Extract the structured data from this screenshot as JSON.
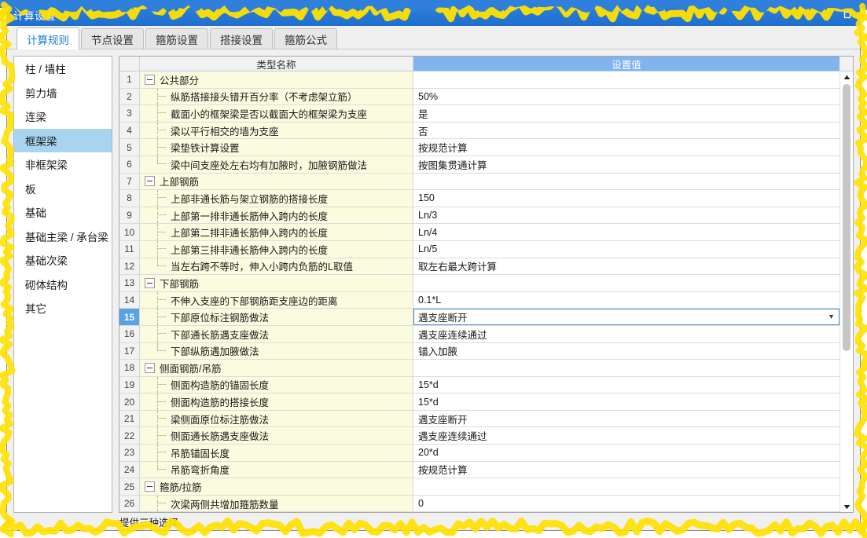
{
  "window": {
    "title": "计算设置",
    "minimize_label": "—",
    "maximize_label": "□"
  },
  "tabs": [
    {
      "label": "计算规则",
      "active": true
    },
    {
      "label": "节点设置",
      "active": false
    },
    {
      "label": "箍筋设置",
      "active": false
    },
    {
      "label": "搭接设置",
      "active": false
    },
    {
      "label": "箍筋公式",
      "active": false
    }
  ],
  "sidebar": {
    "items": [
      {
        "label": "柱 / 墙柱",
        "selected": false
      },
      {
        "label": "剪力墙",
        "selected": false
      },
      {
        "label": "连梁",
        "selected": false
      },
      {
        "label": "框架梁",
        "selected": true
      },
      {
        "label": "非框架梁",
        "selected": false
      },
      {
        "label": "板",
        "selected": false
      },
      {
        "label": "基础",
        "selected": false
      },
      {
        "label": "基础主梁 / 承台梁",
        "selected": false
      },
      {
        "label": "基础次梁",
        "selected": false
      },
      {
        "label": "砌体结构",
        "selected": false
      },
      {
        "label": "其它",
        "selected": false
      }
    ]
  },
  "grid": {
    "headers": {
      "number": "",
      "name": "类型名称",
      "value": "设置值"
    },
    "rows": [
      {
        "num": "1",
        "name": "公共部分",
        "value": "",
        "type": "group"
      },
      {
        "num": "2",
        "name": "纵筋搭接接头错开百分率（不考虑架立筋）",
        "value": "50%",
        "type": "child"
      },
      {
        "num": "3",
        "name": "截面小的框架梁是否以截面大的框架梁为支座",
        "value": "是",
        "type": "child"
      },
      {
        "num": "4",
        "name": "梁以平行相交的墙为支座",
        "value": "否",
        "type": "child"
      },
      {
        "num": "5",
        "name": "梁垫铁计算设置",
        "value": "按规范计算",
        "type": "child"
      },
      {
        "num": "6",
        "name": "梁中间支座处左右均有加腋时，加腋钢筋做法",
        "value": "按图集贯通计算",
        "type": "lastchild"
      },
      {
        "num": "7",
        "name": "上部钢筋",
        "value": "",
        "type": "group"
      },
      {
        "num": "8",
        "name": "上部非通长筋与架立钢筋的搭接长度",
        "value": "150",
        "type": "child"
      },
      {
        "num": "9",
        "name": "上部第一排非通长筋伸入跨内的长度",
        "value": "Ln/3",
        "type": "child"
      },
      {
        "num": "10",
        "name": "上部第二排非通长筋伸入跨内的长度",
        "value": "Ln/4",
        "type": "child"
      },
      {
        "num": "11",
        "name": "上部第三排非通长筋伸入跨内的长度",
        "value": "Ln/5",
        "type": "child"
      },
      {
        "num": "12",
        "name": "当左右跨不等时，伸入小跨内负筋的L取值",
        "value": "取左右最大跨计算",
        "type": "lastchild"
      },
      {
        "num": "13",
        "name": "下部钢筋",
        "value": "",
        "type": "group"
      },
      {
        "num": "14",
        "name": "不伸入支座的下部钢筋距支座边的距离",
        "value": "0.1*L",
        "type": "child"
      },
      {
        "num": "15",
        "name": "下部原位标注钢筋做法",
        "value": "遇支座断开",
        "type": "child",
        "selected": true
      },
      {
        "num": "16",
        "name": "下部通长筋遇支座做法",
        "value": "遇支座连续通过",
        "type": "child"
      },
      {
        "num": "17",
        "name": "下部纵筋遇加腋做法",
        "value": "锚入加腋",
        "type": "lastchild"
      },
      {
        "num": "18",
        "name": "侧面钢筋/吊筋",
        "value": "",
        "type": "group"
      },
      {
        "num": "19",
        "name": "侧面构造筋的锚固长度",
        "value": "15*d",
        "type": "child"
      },
      {
        "num": "20",
        "name": "侧面构造筋的搭接长度",
        "value": "15*d",
        "type": "child"
      },
      {
        "num": "21",
        "name": "梁侧面原位标注筋做法",
        "value": "遇支座断开",
        "type": "child"
      },
      {
        "num": "22",
        "name": "侧面通长筋遇支座做法",
        "value": "遇支座连续通过",
        "type": "child"
      },
      {
        "num": "23",
        "name": "吊筋锚固长度",
        "value": "20*d",
        "type": "child"
      },
      {
        "num": "24",
        "name": "吊筋弯折角度",
        "value": "按规范计算",
        "type": "lastchild"
      },
      {
        "num": "25",
        "name": "箍筋/拉筋",
        "value": "",
        "type": "group"
      },
      {
        "num": "26",
        "name": "次梁两侧共增加箍筋数量",
        "value": "0",
        "type": "child"
      }
    ]
  },
  "statusbar": {
    "text": "提供三种选择。"
  },
  "colors": {
    "titlebar": "#2f7fdc",
    "header_value": "#7fb4ee",
    "row_name_bg": "#fbfbdf",
    "selected_row": "#57a3e8",
    "sidebar_selected": "#a8d4f0",
    "highlight_outline": "#ffe100"
  }
}
